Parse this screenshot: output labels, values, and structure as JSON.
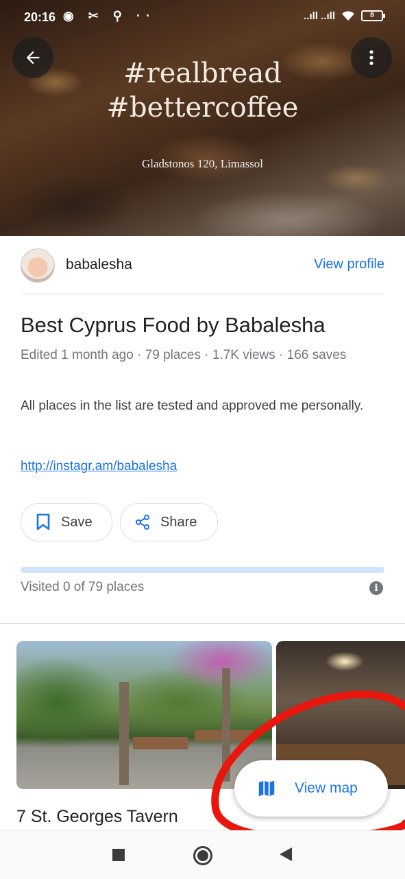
{
  "status_bar": {
    "time": "20:16",
    "left_icons": "◉ ✂ ⚲ ··",
    "signal": "..ıll ..ıll",
    "battery": "8"
  },
  "hero": {
    "tag_line_1": "#realbread",
    "tag_line_2": "#bettercoffee",
    "address": "Gladstonos  120, Limassol"
  },
  "author": {
    "username": "babalesha",
    "view_profile_label": "View profile"
  },
  "list": {
    "title": "Best Cyprus Food by Babalesha",
    "meta": "Edited 1 month ago · 79 places · 1.7K views · 166 saves",
    "description": "All places in the list are tested and approved me personally.",
    "link": "http://instagr.am/babalesha"
  },
  "actions": {
    "save_label": "Save",
    "share_label": "Share"
  },
  "progress": {
    "visited_text": "Visited 0 of 79 places",
    "visited": 0,
    "total": 79
  },
  "places": [
    {
      "name": "7 St. Georges Tavern"
    }
  ],
  "fab": {
    "label": "View map"
  },
  "colors": {
    "accent": "#1a73e8",
    "annotation": "#e8160c"
  }
}
